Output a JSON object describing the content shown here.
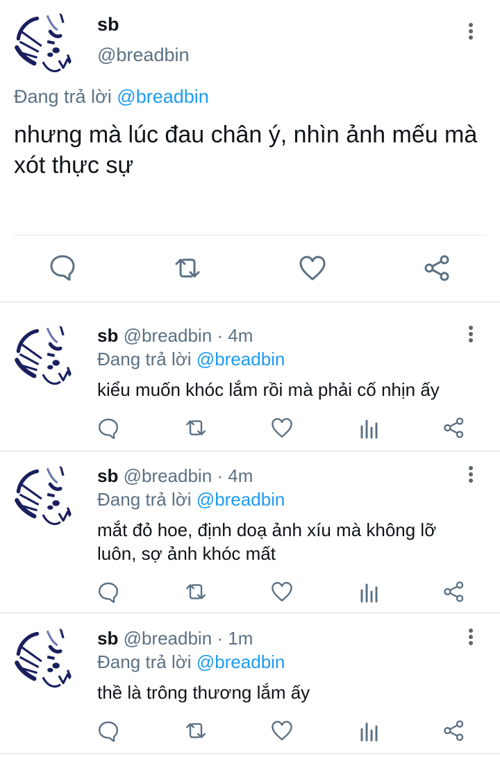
{
  "main_tweet": {
    "name": "sb",
    "handle": "@breadbin",
    "reply_prefix": "Đang trả lời",
    "reply_to": "@breadbin",
    "text_line1": "nhưng mà lúc đau chân ý, nhìn ảnh mếu mà",
    "text_line2": "xót thực sự"
  },
  "replies": [
    {
      "name": "sb",
      "meta": "@breadbin · 4m",
      "reply_prefix": "Đang trả lời",
      "reply_to": "@breadbin",
      "text_line1": "kiểu muốn khóc lắm rồi mà phải cố nhịn ấy",
      "text_line2": ""
    },
    {
      "name": "sb",
      "meta": "@breadbin · 4m",
      "reply_prefix": "Đang trả lời",
      "reply_to": "@breadbin",
      "text_line1": "mắt đỏ hoe, định doạ ảnh xíu mà không lỡ",
      "text_line2": "luôn, sợ ảnh khóc mất"
    },
    {
      "name": "sb",
      "meta": "@breadbin · 1m",
      "reply_prefix": "Đang trả lời",
      "reply_to": "@breadbin",
      "text_line1": "thề là trông thương lắm ấy",
      "text_line2": ""
    }
  ],
  "colors": {
    "accent": "#1d9bf0",
    "icon": "#5b7083",
    "avatar_ink": "#1a1f5e"
  }
}
